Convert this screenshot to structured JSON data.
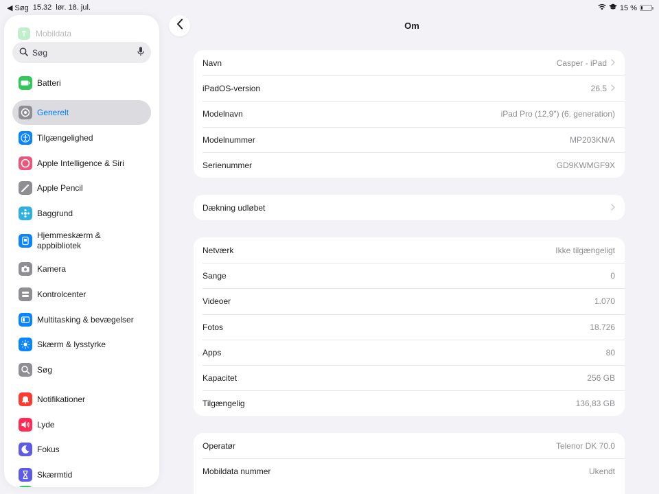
{
  "statusbar": {
    "back_app": "◀ Søg",
    "time": "15.32",
    "date": "lør. 18. jul.",
    "battery_text": "15 %",
    "battery_level": 0.15
  },
  "sidebar": {
    "faded_item": "Mobildata",
    "search_placeholder": "Søg",
    "items": [
      {
        "label": "Batteri",
        "icon": "battery-icon",
        "color": "#34c759"
      },
      {
        "label": "Generelt",
        "icon": "gear-icon",
        "color": "#8e8e93"
      },
      {
        "label": "Tilgængelighed",
        "icon": "accessibility-icon",
        "color": "#0a84ff"
      },
      {
        "label": "Apple Intelligence & Siri",
        "icon": "siri-icon",
        "color": "#e9577c"
      },
      {
        "label": "Apple Pencil",
        "icon": "pencil-icon",
        "color": "#8e8e93"
      },
      {
        "label": "Baggrund",
        "icon": "wallpaper-icon",
        "color": "#30b0e0"
      },
      {
        "label": "Hjemmeskærm & appbibliotek",
        "icon": "home-screen-icon",
        "color": "#0a84ff"
      },
      {
        "label": "Kamera",
        "icon": "camera-icon",
        "color": "#8e8e93"
      },
      {
        "label": "Kontrolcenter",
        "icon": "control-center-icon",
        "color": "#8e8e93"
      },
      {
        "label": "Multitasking & bevægelser",
        "icon": "multitasking-icon",
        "color": "#0a84ff"
      },
      {
        "label": "Skærm & lysstyrke",
        "icon": "brightness-icon",
        "color": "#0a84ff"
      },
      {
        "label": "Søg",
        "icon": "search-icon",
        "color": "#8e8e93"
      },
      {
        "label": "Notifikationer",
        "icon": "bell-icon",
        "color": "#ff3b30"
      },
      {
        "label": "Lyde",
        "icon": "speaker-icon",
        "color": "#ff2d55"
      },
      {
        "label": "Fokus",
        "icon": "moon-icon",
        "color": "#5e5ce6"
      },
      {
        "label": "Skærmtid",
        "icon": "hourglass-icon",
        "color": "#5e5ce6"
      }
    ]
  },
  "main": {
    "title": "Om",
    "groups": [
      [
        {
          "label": "Navn",
          "value": "Casper - iPad",
          "chevron": true
        },
        {
          "label": "iPadOS-version",
          "value": "26.5",
          "chevron": true
        },
        {
          "label": "Modelnavn",
          "value": "iPad Pro (12,9\") (6. generation)",
          "chevron": false
        },
        {
          "label": "Modelnummer",
          "value": "MP203KN/A",
          "chevron": false
        },
        {
          "label": "Serienummer",
          "value": "GD9KWMGF9X",
          "chevron": false
        }
      ],
      [
        {
          "label": "Dækning udløbet",
          "value": "",
          "chevron": true
        }
      ],
      [
        {
          "label": "Netværk",
          "value": "Ikke tilgængeligt",
          "chevron": false
        },
        {
          "label": "Sange",
          "value": "0",
          "chevron": false
        },
        {
          "label": "Videoer",
          "value": "1.070",
          "chevron": false
        },
        {
          "label": "Fotos",
          "value": "18.726",
          "chevron": false
        },
        {
          "label": "Apps",
          "value": "80",
          "chevron": false
        },
        {
          "label": "Kapacitet",
          "value": "256 GB",
          "chevron": false
        },
        {
          "label": "Tilgængelig",
          "value": "136,83 GB",
          "chevron": false
        }
      ],
      [
        {
          "label": "Operatør",
          "value": "Telenor DK 70.0",
          "chevron": false
        },
        {
          "label": "Mobildata nummer",
          "value": "Ukendt",
          "chevron": false
        }
      ]
    ]
  }
}
